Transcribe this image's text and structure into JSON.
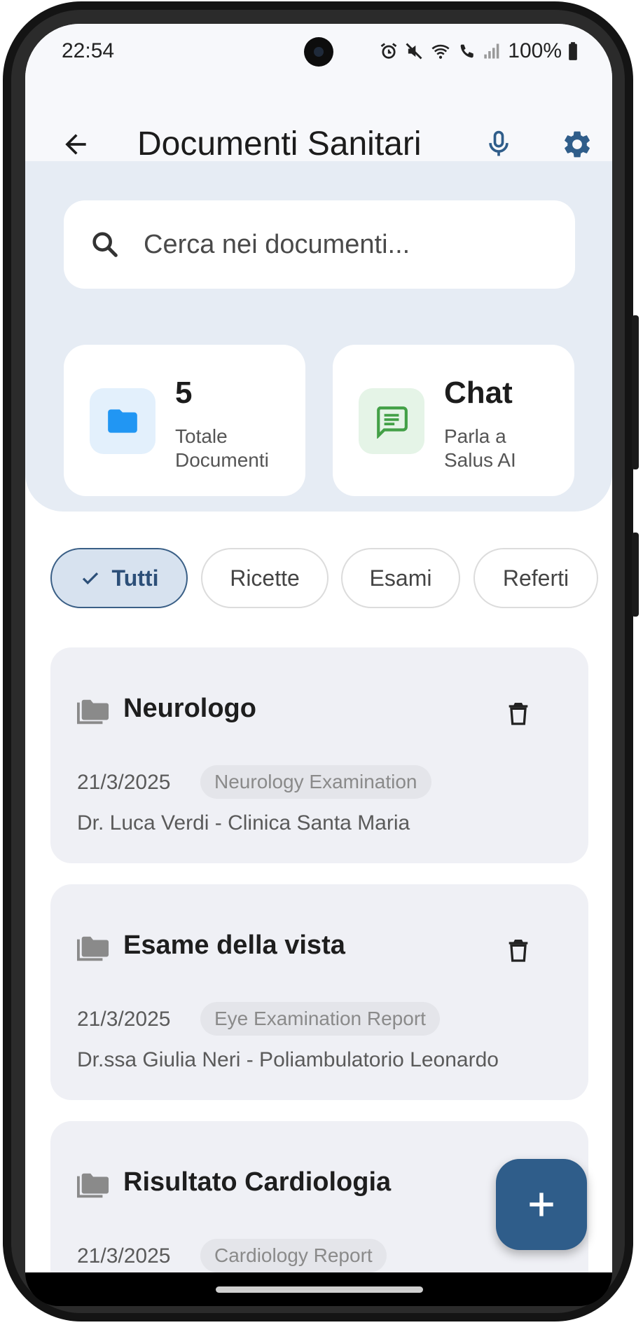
{
  "status_bar": {
    "time": "22:54",
    "battery": "100%"
  },
  "app_bar": {
    "title": "Documenti Sanitari"
  },
  "search": {
    "placeholder": "Cerca nei documenti..."
  },
  "stats": [
    {
      "value": "5",
      "line1": "Totale",
      "line2": "Documenti",
      "icon": "folder-icon",
      "color": "#2196f3",
      "bg": "#e3f0fc"
    },
    {
      "value": "Chat",
      "line1": "Parla a",
      "line2": "Salus AI",
      "icon": "chat-icon",
      "color": "#43a047",
      "bg": "#e5f4e7"
    }
  ],
  "filters": [
    {
      "label": "Tutti",
      "selected": true
    },
    {
      "label": "Ricette",
      "selected": false
    },
    {
      "label": "Esami",
      "selected": false
    },
    {
      "label": "Referti",
      "selected": false
    }
  ],
  "documents": [
    {
      "title": "Neurologo",
      "date": "21/3/2025",
      "tag": "Neurology Examination",
      "author": "Dr. Luca Verdi - Clinica Santa Maria"
    },
    {
      "title": "Esame della vista",
      "date": "21/3/2025",
      "tag": "Eye Examination Report",
      "author": "Dr.ssa Giulia Neri - Poliambulatorio Leonardo"
    },
    {
      "title": "Risultato Cardiologia",
      "date": "21/3/2025",
      "tag": "Cardiology Report",
      "author": ""
    }
  ],
  "colors": {
    "accent": "#2f5d8a",
    "header_bg": "#e6ecf4",
    "card_bg": "#eff0f5"
  }
}
